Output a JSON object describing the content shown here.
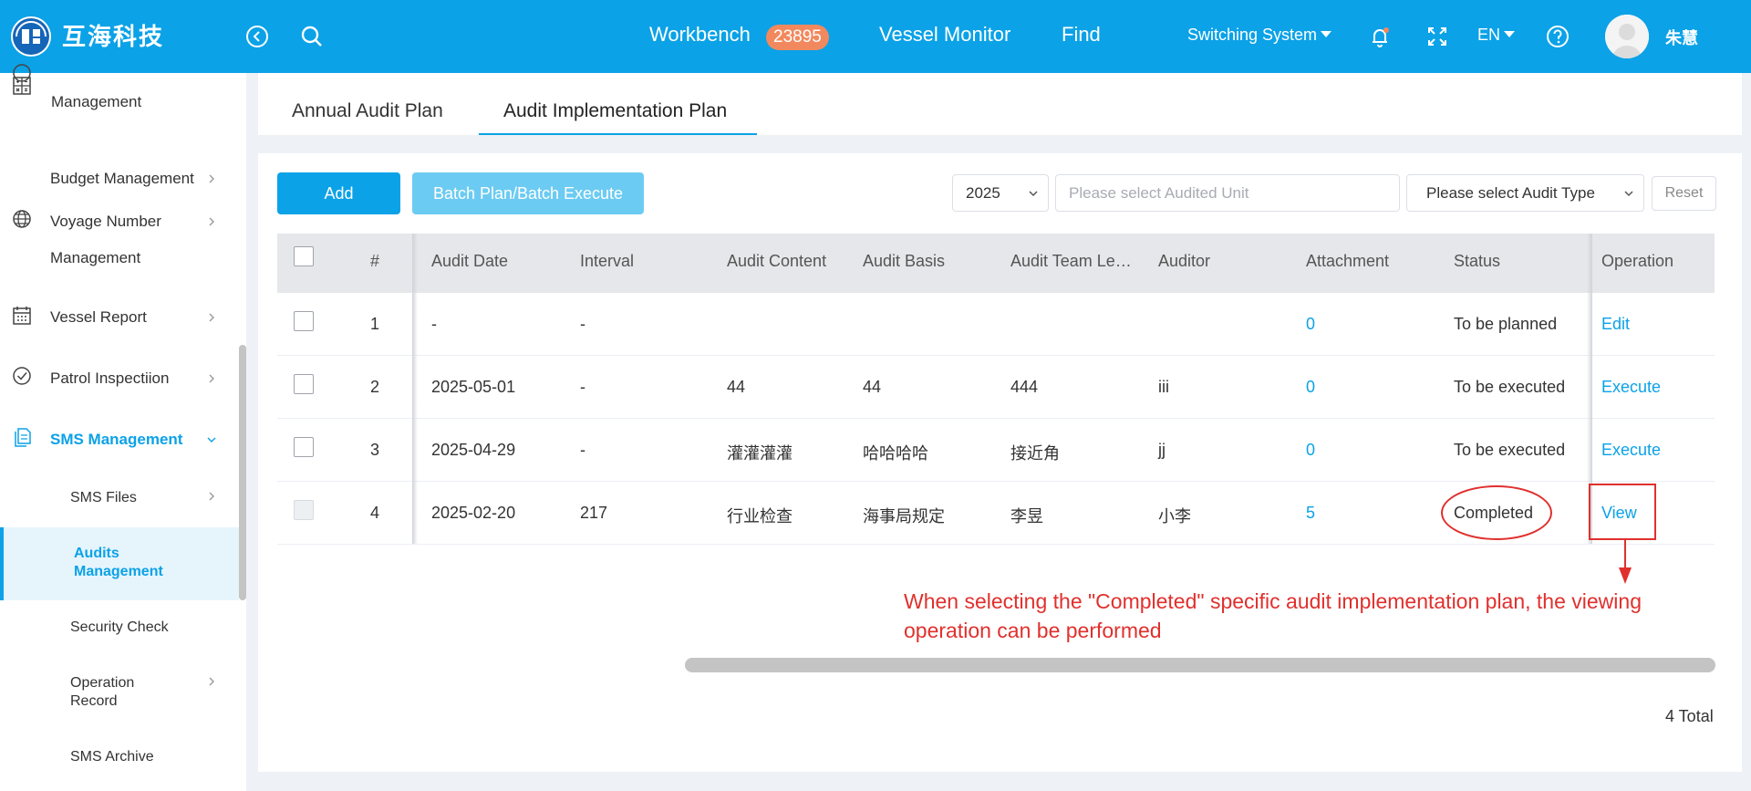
{
  "header": {
    "brand": "互海科技",
    "nav": {
      "workbench": "Workbench",
      "workbench_badge": "23895",
      "vessel_monitor": "Vessel Monitor",
      "find": "Find"
    },
    "switching_system": "Switching System",
    "language": "EN",
    "user_name": "朱慧"
  },
  "sidebar": {
    "partial_item": "Management",
    "items": [
      {
        "label": "Budget Management"
      },
      {
        "label_line1": "Voyage Number",
        "label_line2": "Management"
      },
      {
        "label": "Vessel Report"
      },
      {
        "label": "Patrol Inspectiion"
      },
      {
        "label": "SMS Management"
      }
    ],
    "sub_items": [
      {
        "label": "SMS Files"
      },
      {
        "label_line1": "Audits",
        "label_line2": "Management"
      },
      {
        "label": "Security Check"
      },
      {
        "label_line1": "Operation",
        "label_line2": "Record"
      },
      {
        "label": "SMS Archive"
      }
    ]
  },
  "tabs": [
    {
      "label": "Annual Audit Plan"
    },
    {
      "label": "Audit Implementation Plan"
    }
  ],
  "toolbar": {
    "add_label": "Add",
    "batch_label": "Batch Plan/Batch Execute",
    "year_value": "2025",
    "unit_placeholder": "Please select Audited Unit",
    "audit_type_placeholder": "Please select Audit Type",
    "reset_label": "Reset"
  },
  "table": {
    "columns": [
      "#",
      "Audit Date",
      "Interval",
      "Audit Content",
      "Audit Basis",
      "Audit Team Le…",
      "Auditor",
      "Attachment",
      "Status",
      "Operation"
    ],
    "rows": [
      {
        "index": "1",
        "date": "-",
        "interval": "-",
        "content": "",
        "basis": "",
        "leader": "",
        "auditor": "",
        "attachment": "0",
        "status": "To be planned",
        "operation": "Edit"
      },
      {
        "index": "2",
        "date": "2025-05-01",
        "interval": "-",
        "content": "44",
        "basis": "44",
        "leader": "444",
        "auditor": "iii",
        "attachment": "0",
        "status": "To be executed",
        "operation": "Execute"
      },
      {
        "index": "3",
        "date": "2025-04-29",
        "interval": "-",
        "content": "灌灌灌灌",
        "basis": "哈哈哈哈",
        "leader": "接近角",
        "auditor": "jj",
        "attachment": "0",
        "status": "To be executed",
        "operation": "Execute"
      },
      {
        "index": "4",
        "date": "2025-02-20",
        "interval": "217",
        "content": "行业检查",
        "basis": "海事局规定",
        "leader": "李昱",
        "auditor": "小李",
        "attachment": "5",
        "status": "Completed",
        "operation": "View"
      }
    ]
  },
  "annotation": "When selecting the \"Completed\" specific audit implementation plan, the viewing operation can be performed",
  "total": "4 Total",
  "colors": {
    "primary": "#0ba2e7",
    "primary_light": "#6ccbf2",
    "badge": "#f2895e",
    "annotation_red": "#e0302d"
  }
}
